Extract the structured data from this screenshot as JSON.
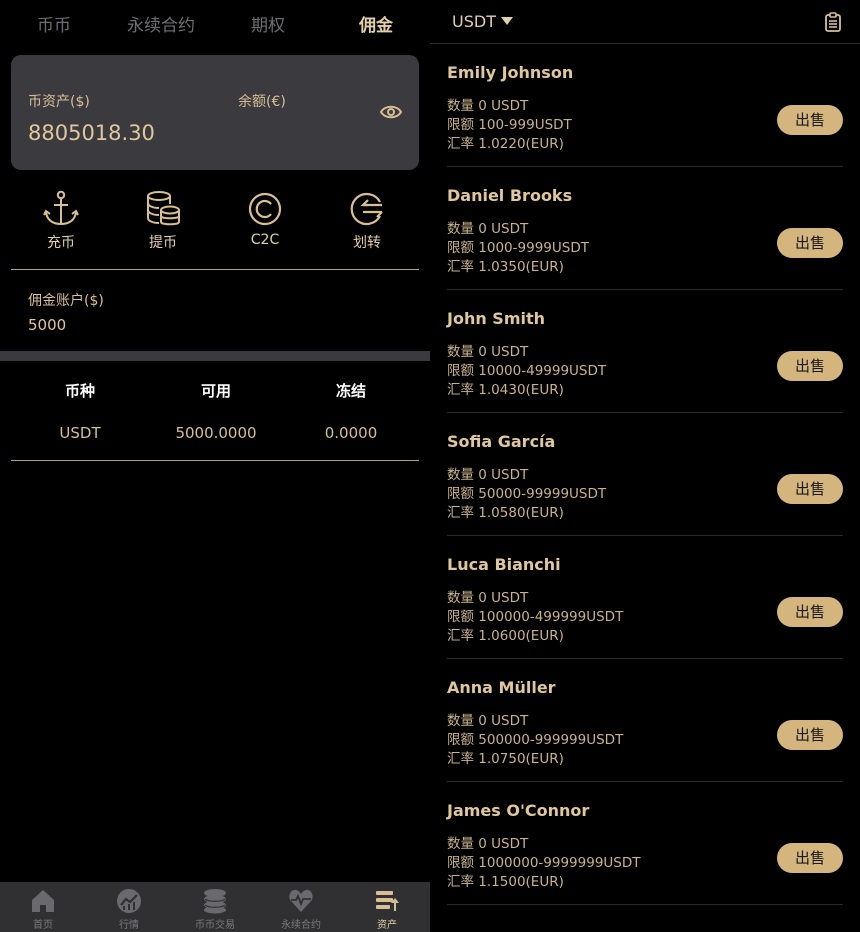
{
  "left": {
    "tabs": [
      {
        "label": "币币"
      },
      {
        "label": "永续合约"
      },
      {
        "label": "期权"
      },
      {
        "label": "佣金"
      }
    ],
    "active_tab": 3,
    "asset": {
      "coin_assets_label": "币资产($)",
      "balance_label": "余额(€)",
      "amount": "8805018.30"
    },
    "actions": [
      {
        "label": "充币",
        "icon": "anchor-icon"
      },
      {
        "label": "提币",
        "icon": "coin-stack-icon"
      },
      {
        "label": "C2C",
        "icon": "c2c-icon"
      },
      {
        "label": "划转",
        "icon": "transfer-icon"
      }
    ],
    "commission": {
      "label": "佣金账户($)",
      "value": "5000"
    },
    "table": {
      "headers": [
        "币种",
        "可用",
        "冻结"
      ],
      "rows": [
        [
          "USDT",
          "5000.0000",
          "0.0000"
        ]
      ]
    },
    "bottom_nav": [
      {
        "label": "首页",
        "icon": "home-icon"
      },
      {
        "label": "行情",
        "icon": "market-icon"
      },
      {
        "label": "币币交易",
        "icon": "coins-icon"
      },
      {
        "label": "永续合约",
        "icon": "heart-rate-icon"
      },
      {
        "label": "资产",
        "icon": "assets-icon"
      }
    ],
    "active_nav": 4
  },
  "right": {
    "currency": "USDT",
    "offers": [
      {
        "name": "Emily Johnson",
        "qty": "数量 0 USDT",
        "limit": "限额 100-999USDT",
        "rate": "汇率 1.0220(EUR)",
        "sell": "出售"
      },
      {
        "name": "Daniel Brooks",
        "qty": "数量 0 USDT",
        "limit": "限额 1000-9999USDT",
        "rate": "汇率 1.0350(EUR)",
        "sell": "出售"
      },
      {
        "name": "John Smith",
        "qty": "数量 0 USDT",
        "limit": "限额 10000-49999USDT",
        "rate": "汇率 1.0430(EUR)",
        "sell": "出售"
      },
      {
        "name": "Sofia García",
        "qty": "数量 0 USDT",
        "limit": "限额 50000-99999USDT",
        "rate": "汇率 1.0580(EUR)",
        "sell": "出售"
      },
      {
        "name": "Luca Bianchi",
        "qty": "数量 0 USDT",
        "limit": "限额 100000-499999USDT",
        "rate": "汇率 1.0600(EUR)",
        "sell": "出售"
      },
      {
        "name": "Anna Müller",
        "qty": "数量 0 USDT",
        "limit": "限额 500000-999999USDT",
        "rate": "汇率 1.0750(EUR)",
        "sell": "出售"
      },
      {
        "name": "James O'Connor",
        "qty": "数量 0 USDT",
        "limit": "限额 1000000-9999999USDT",
        "rate": "汇率 1.1500(EUR)",
        "sell": "出售"
      }
    ]
  },
  "colors": {
    "accent": "#d4b57e",
    "card": "#3a3a3f",
    "background": "#000000"
  }
}
